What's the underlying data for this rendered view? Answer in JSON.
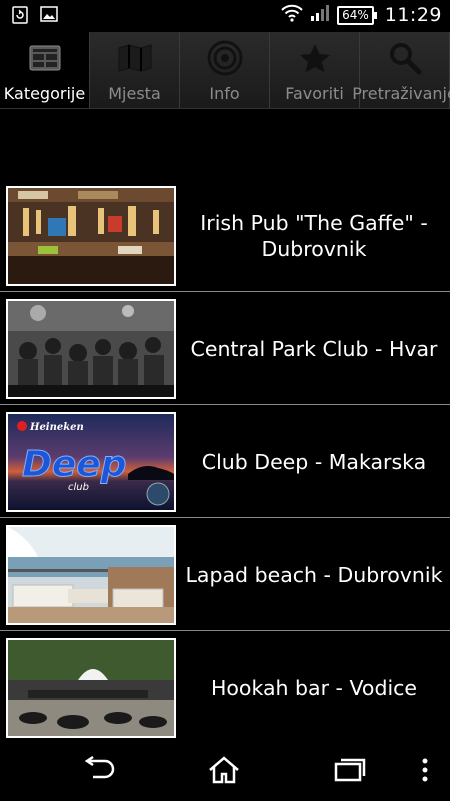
{
  "status": {
    "battery": "64%",
    "time": "11:29",
    "left_icons": [
      "sync-notification-icon",
      "image-notification-icon"
    ],
    "right_icons": [
      "wifi-icon",
      "signal-icon",
      "battery-icon"
    ]
  },
  "tabs": [
    {
      "label": "Kategorije",
      "icon": "grid-icon",
      "active": true
    },
    {
      "label": "Mjesta",
      "icon": "map-icon",
      "active": false
    },
    {
      "label": "Info",
      "icon": "target-icon",
      "active": false
    },
    {
      "label": "Favoriti",
      "icon": "star-icon",
      "active": false
    },
    {
      "label": "Pretraživanje",
      "icon": "search-icon",
      "active": false
    }
  ],
  "items": [
    {
      "title": "Irish Pub \"The Gaffe\" - Dubrovnik"
    },
    {
      "title": "Central Park Club - Hvar"
    },
    {
      "title": "Club Deep - Makarska",
      "thumb_text": {
        "brand": "Heineken",
        "name": "Deep",
        "sub": "club"
      }
    },
    {
      "title": "Lapad beach - Dubrovnik"
    },
    {
      "title": "Hookah bar - Vodice"
    }
  ],
  "nav": [
    "back-icon",
    "home-icon",
    "recent-apps-icon",
    "menu-overflow-icon"
  ]
}
